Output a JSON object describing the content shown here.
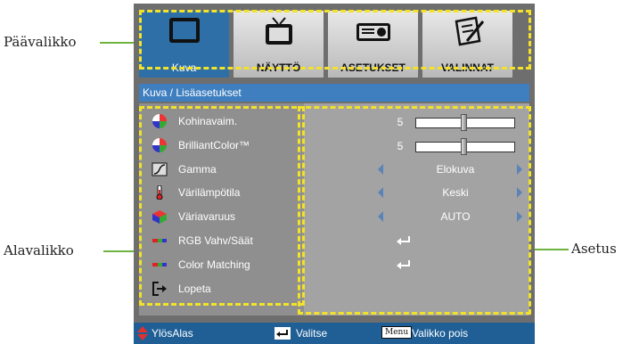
{
  "callouts": {
    "main_menu": "Päävalikko",
    "sub_menu": "Alavalikko",
    "setting": "Asetus"
  },
  "tabs": [
    {
      "label": "Kuva",
      "icon": "picture-icon",
      "active": true
    },
    {
      "label": "NÄYTTÖ",
      "icon": "tv-icon",
      "active": false
    },
    {
      "label": "ASETUKSET",
      "icon": "projector-icon",
      "active": false
    },
    {
      "label": "VALINNAT",
      "icon": "options-icon",
      "active": false
    }
  ],
  "breadcrumb": "Kuva / Lisäasetukset",
  "items": [
    {
      "label": "Kohinavaim.",
      "icon": "color-wheel-icon",
      "value": "5",
      "control": "slider",
      "level": 0.5
    },
    {
      "label": "BrilliantColor™",
      "icon": "color-wheel-icon",
      "value": "5",
      "control": "slider",
      "level": 0.5
    },
    {
      "label": "Gamma",
      "icon": "gamma-curve-icon",
      "value": "Elokuva",
      "control": "choice"
    },
    {
      "label": "Värilämpötila",
      "icon": "thermometer-icon",
      "value": "Keski",
      "control": "choice"
    },
    {
      "label": "Väriavaruus",
      "icon": "color-cube-icon",
      "value": "AUTO",
      "control": "choice"
    },
    {
      "label": "RGB Vahv/Säät",
      "icon": "rgb-bar-icon",
      "control": "enter"
    },
    {
      "label": "Color Matching",
      "icon": "rgb-bar-icon",
      "control": "enter"
    },
    {
      "label": "Lopeta",
      "icon": "exit-icon",
      "control": "none"
    }
  ],
  "footer": {
    "nav": "YlösAlas",
    "select": "Valitse",
    "menu_key": "Menu",
    "exit": "Valikko pois"
  },
  "colors": {
    "highlight_dash": "#f2e229",
    "callout_line": "#6db33f",
    "active_tab": "#2e6fa8",
    "footer_bar": "#1f5f96"
  }
}
